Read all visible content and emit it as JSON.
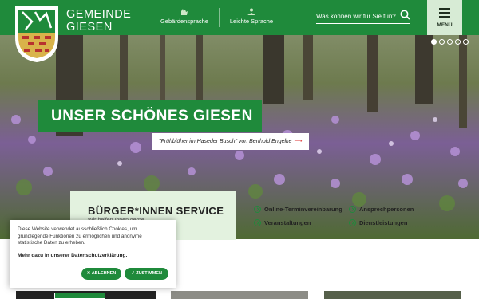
{
  "header": {
    "brand_line1": "GEMEINDE",
    "brand_line2": "GIESEN",
    "links": [
      {
        "label": "Gebärdensprache",
        "icon": "sign-language-icon"
      },
      {
        "label": "Leichte Sprache",
        "icon": "easy-language-icon"
      }
    ],
    "search": {
      "placeholder": "Was können wir für Sie tun?",
      "icon": "search-icon"
    },
    "menu_label": "MENÜ"
  },
  "slider": {
    "slide_count": 5,
    "active_index": 0
  },
  "hero": {
    "title": "UNSER SCHÖNES GIESEN",
    "caption": "\"Frühblüher im Haseder Busch\" von Berthold Engelke"
  },
  "service": {
    "title": "BÜRGER*INNEN SERVICE",
    "subtitle": "Wir helfen Ihnen gerne",
    "links": [
      {
        "label": "Online-Terminvereinbarung"
      },
      {
        "label": "Ansprechpersonen"
      },
      {
        "label": "Veranstaltungen"
      },
      {
        "label": "Dienstleistungen"
      }
    ]
  },
  "cookie": {
    "text": "Diese Website verwendet ausschließlich Cookies, um grundlegende Funktionen zu ermöglichen und anonyme statistische Daten zu erheben.",
    "more_link": "Mehr dazu in unserer Datenschutzerklärung.",
    "reject_label": "ABLEHNEN",
    "accept_label": "ZUSTIMMEN"
  },
  "colors": {
    "brand_green": "#1f8a3b",
    "light_green": "#e3f2df",
    "menu_bg": "#d7ebd5",
    "caption_arrow": "#dd3333"
  }
}
